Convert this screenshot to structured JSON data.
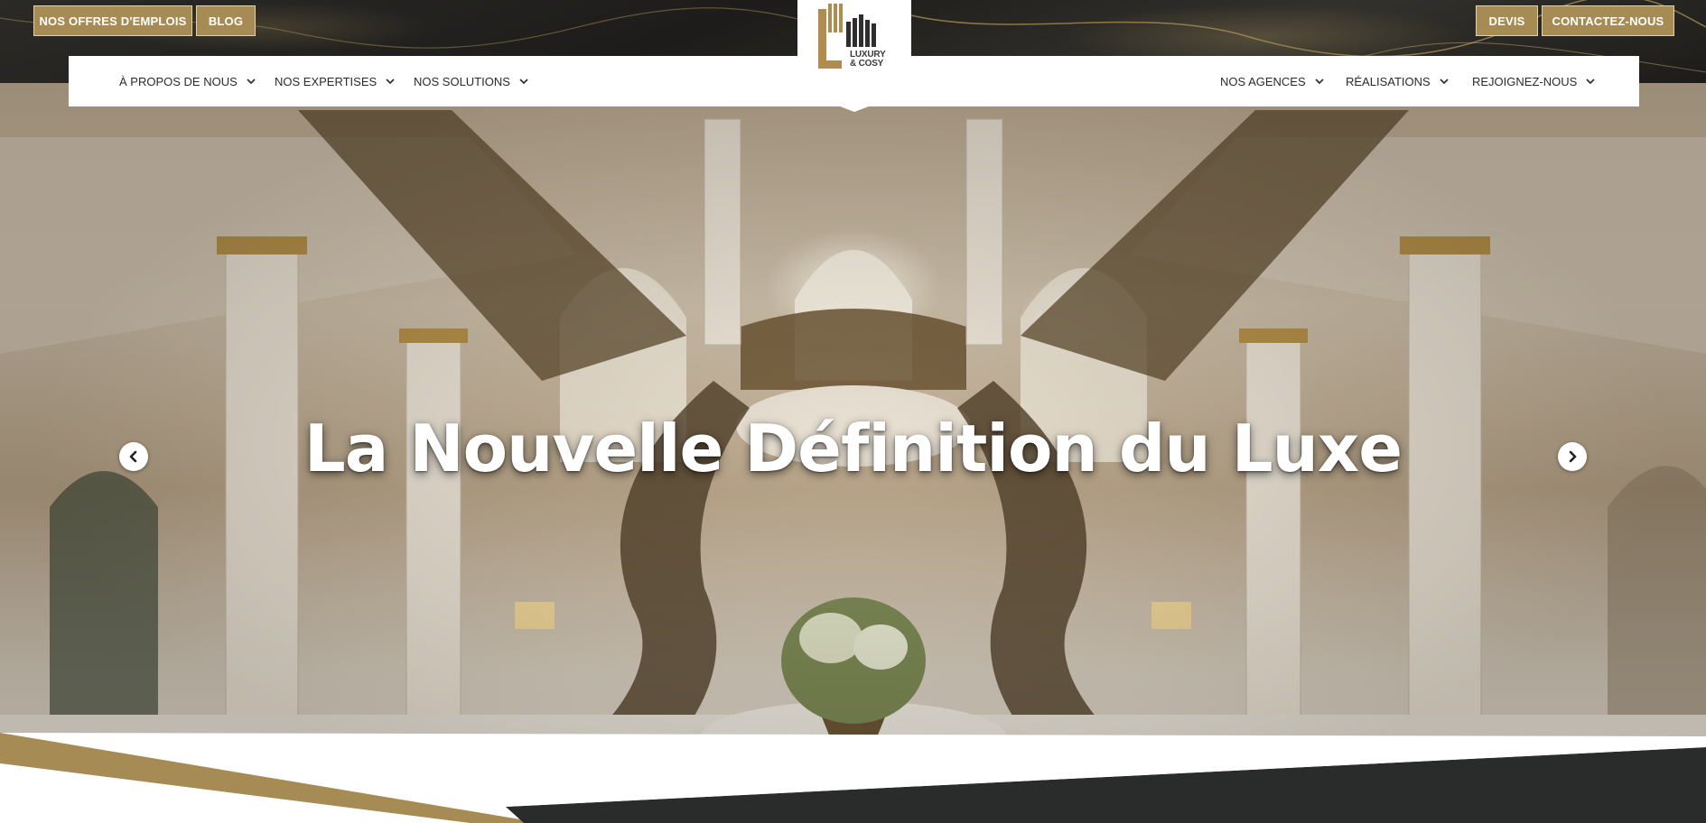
{
  "top_bar": {
    "jobs_label": "NOS OFFRES D'EMPLOIS",
    "blog_label": "BLOG",
    "quote_label": "DEVIS",
    "contact_label": "CONTACTEZ-NOUS"
  },
  "logo": {
    "line1": "LUXURY",
    "line2": "& COSY"
  },
  "nav": {
    "left": [
      {
        "label": "À PROPOS DE NOUS"
      },
      {
        "label": "NOS EXPERTISES"
      },
      {
        "label": "NOS SOLUTIONS"
      }
    ],
    "right": [
      {
        "label": "NOS AGENCES"
      },
      {
        "label": "RÉALISATIONS"
      },
      {
        "label": "REJOIGNEZ-NOUS"
      }
    ]
  },
  "hero": {
    "title": "La Nouvelle Définition du Luxe",
    "image_subject": "luxury-marble-hall-with-double-staircase"
  },
  "colors": {
    "gold": "#a78b54",
    "dark": "#2a2c2c",
    "white": "#ffffff"
  },
  "icons": {
    "prev": "chevron-left-circle-icon",
    "next": "chevron-right-circle-icon",
    "dropdown": "chevron-down-icon"
  }
}
